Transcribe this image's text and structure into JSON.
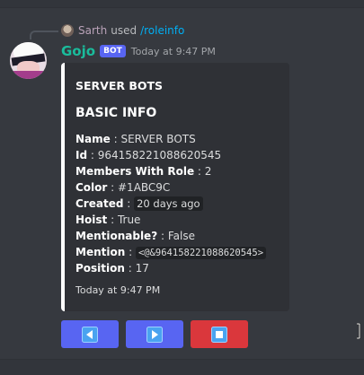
{
  "reply": {
    "user": "Sarth",
    "used_text": "used",
    "command": "/roleinfo"
  },
  "message": {
    "username": "Gojo",
    "bot_tag": "BOT",
    "timestamp": "Today at 9:47 PM"
  },
  "embed": {
    "accent_color": "#ffffff",
    "author": "SERVER BOTS",
    "title": "BASIC INFO",
    "fields": {
      "name": {
        "label": "Name",
        "value": "SERVER BOTS"
      },
      "id": {
        "label": "Id",
        "value": "964158221088620545"
      },
      "members": {
        "label": "Members With Role",
        "value": "2"
      },
      "color": {
        "label": "Color",
        "value": "#1ABC9C"
      },
      "created": {
        "label": "Created",
        "value": "20 days ago"
      },
      "hoist": {
        "label": "Hoist",
        "value": "True"
      },
      "mentionable": {
        "label": "Mentionable?",
        "value": "False"
      },
      "mention": {
        "label": "Mention",
        "value": "<@&964158221088620545>"
      },
      "position": {
        "label": "Position",
        "value": "17"
      }
    },
    "footer": "Today at 9:47 PM"
  },
  "buttons": {
    "prev": {
      "icon": "arrow-left-icon",
      "color": "#5865f2"
    },
    "next": {
      "icon": "arrow-right-icon",
      "color": "#5865f2"
    },
    "stop": {
      "icon": "stop-square-icon",
      "color": "#da373c"
    }
  },
  "colors": {
    "background": "#36393f",
    "embed_background": "#2f3136",
    "username": "#1abc9c",
    "link": "#00aff4",
    "blurple": "#5865f2",
    "danger": "#da373c"
  }
}
